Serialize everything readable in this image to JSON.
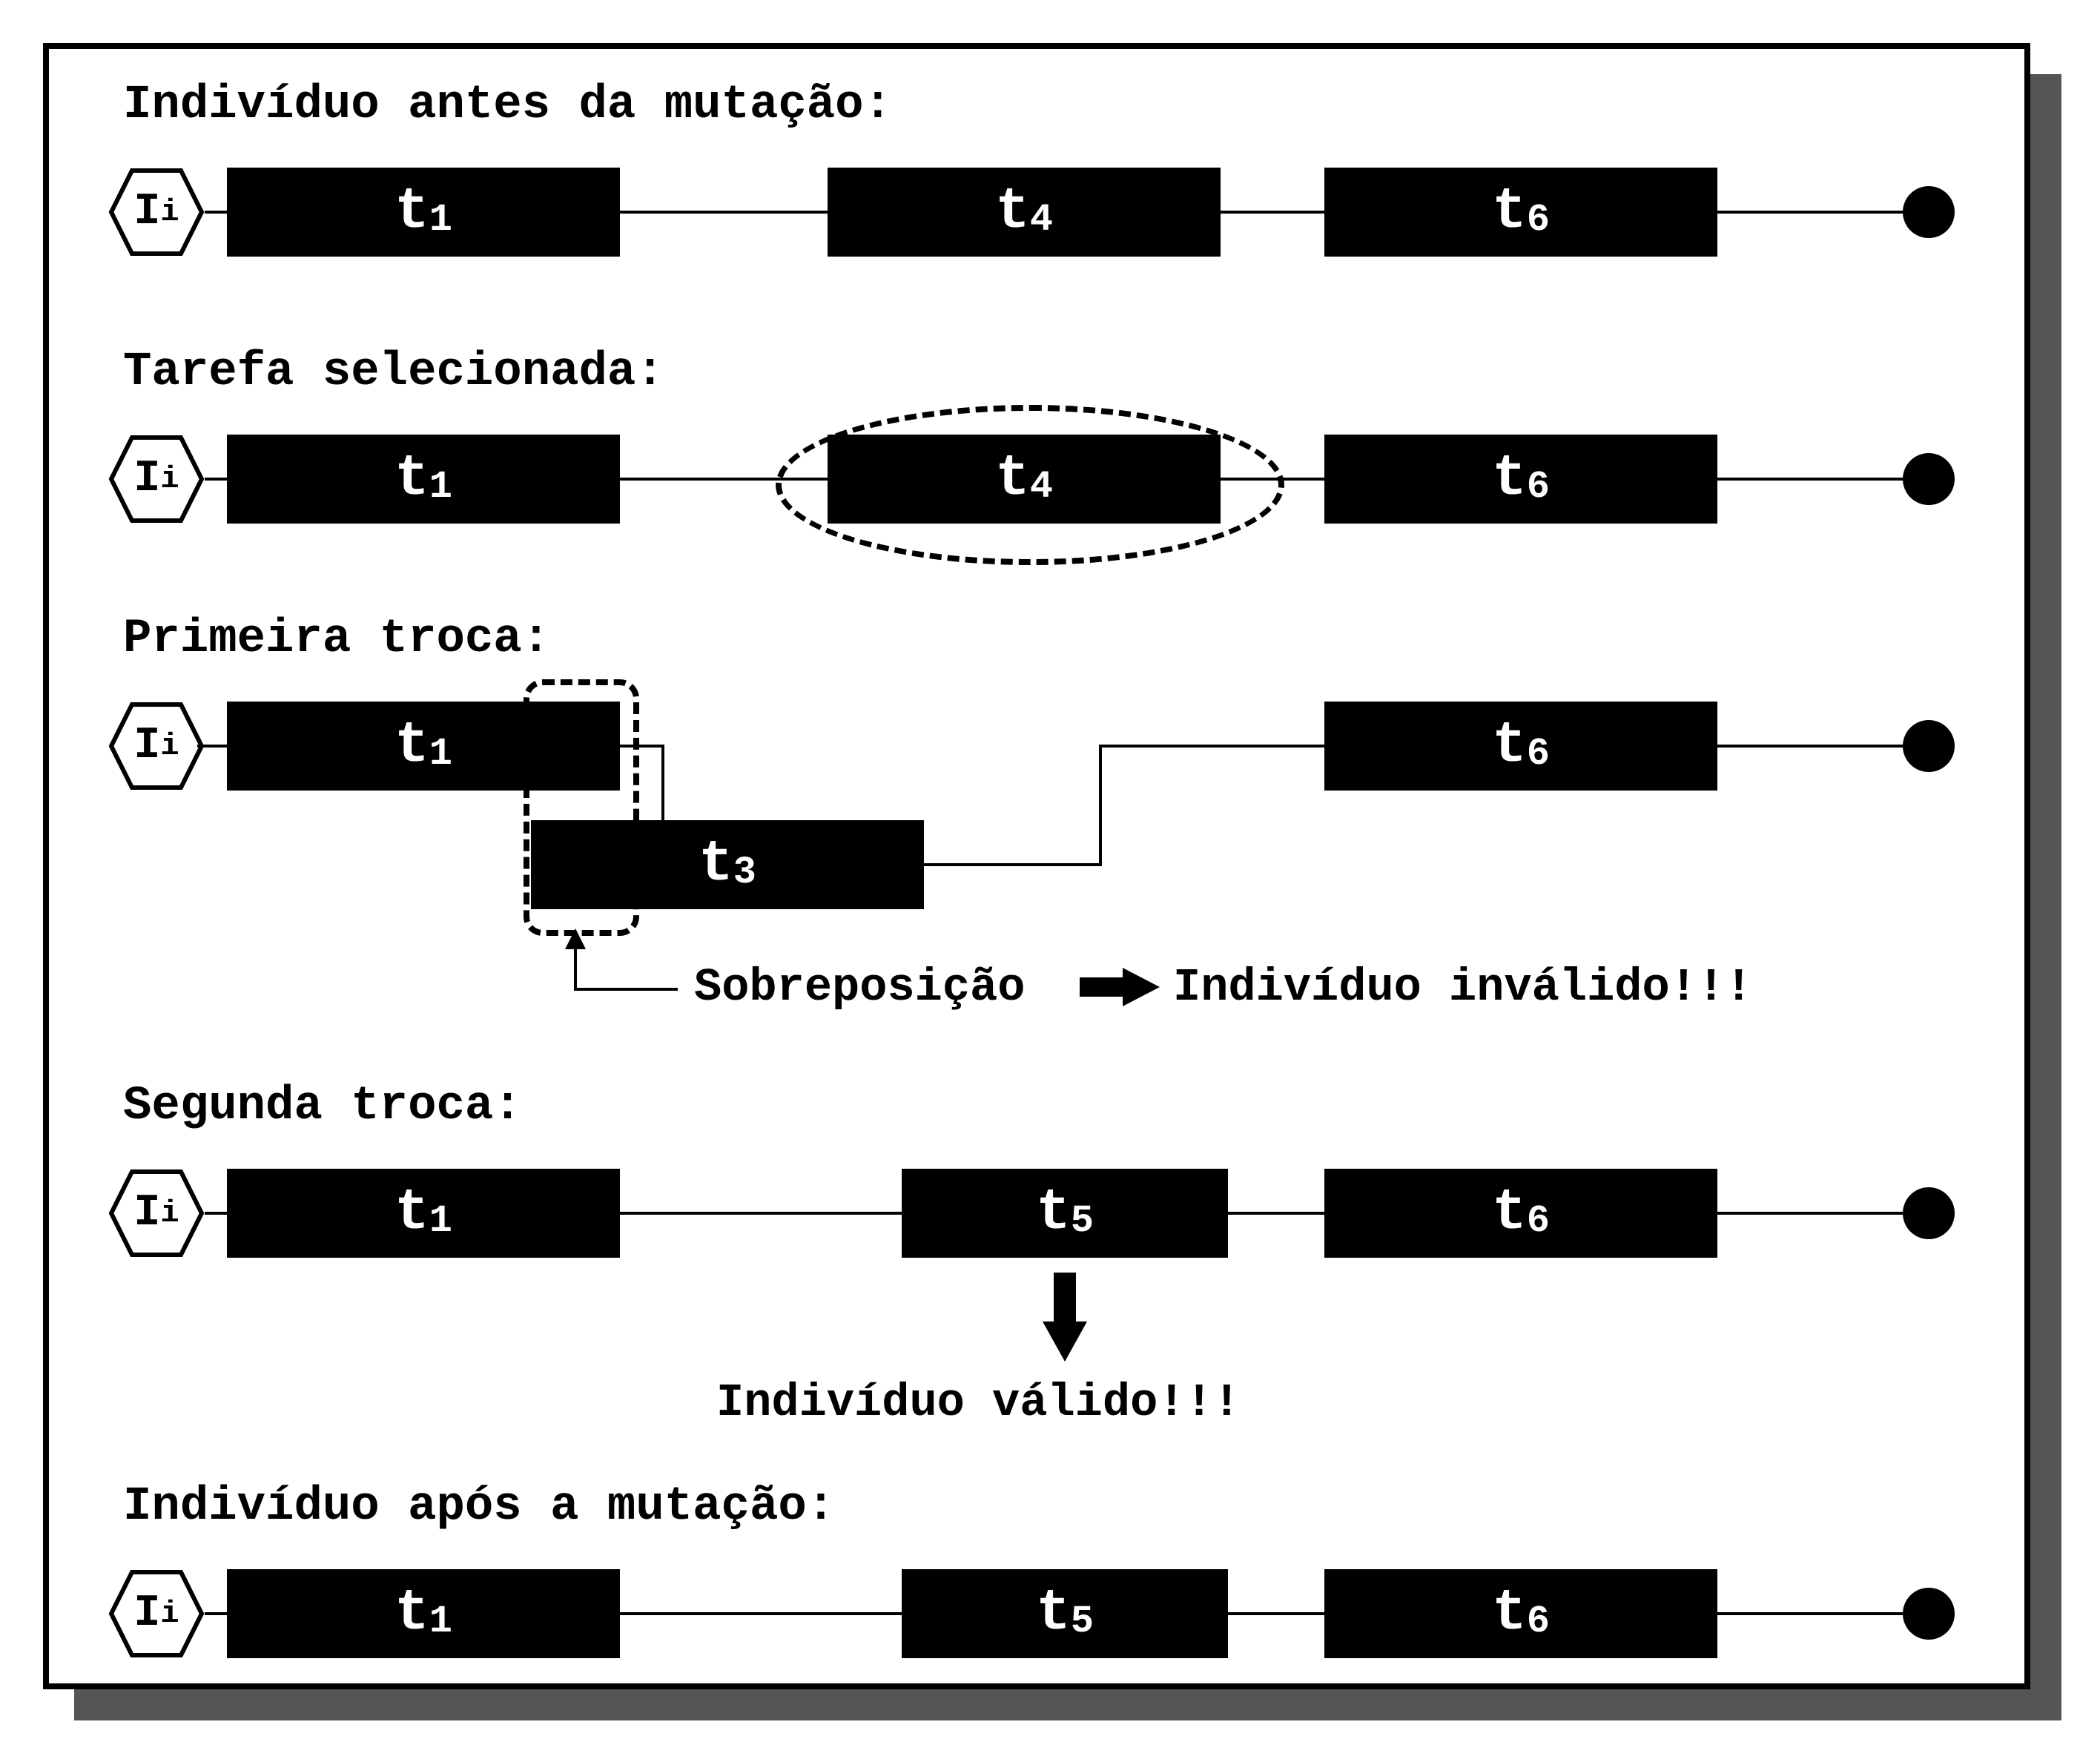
{
  "individual_label": {
    "main": "I",
    "sub": "i"
  },
  "sections": {
    "before": {
      "title": "Indivíduo antes da mutação:",
      "tasks": [
        {
          "main": "t",
          "sub": "1"
        },
        {
          "main": "t",
          "sub": "4"
        },
        {
          "main": "t",
          "sub": "6"
        }
      ]
    },
    "selected": {
      "title": "Tarefa selecionada:",
      "tasks": [
        {
          "main": "t",
          "sub": "1"
        },
        {
          "main": "t",
          "sub": "4"
        },
        {
          "main": "t",
          "sub": "6"
        }
      ],
      "selected_index": 1
    },
    "swap1": {
      "title": "Primeira troca:",
      "tasks_top": [
        {
          "main": "t",
          "sub": "1"
        },
        {
          "main": "t",
          "sub": "6"
        }
      ],
      "task_bottom": {
        "main": "t",
        "sub": "3"
      },
      "overlap_label": "Sobreposição",
      "invalid_label": "Indivíduo inválido!!!"
    },
    "swap2": {
      "title": "Segunda troca:",
      "tasks": [
        {
          "main": "t",
          "sub": "1"
        },
        {
          "main": "t",
          "sub": "5"
        },
        {
          "main": "t",
          "sub": "6"
        }
      ],
      "valid_label": "Indivíduo válido!!!"
    },
    "after": {
      "title": "Indivíduo após a mutação:",
      "tasks": [
        {
          "main": "t",
          "sub": "1"
        },
        {
          "main": "t",
          "sub": "5"
        },
        {
          "main": "t",
          "sub": "6"
        }
      ]
    }
  }
}
